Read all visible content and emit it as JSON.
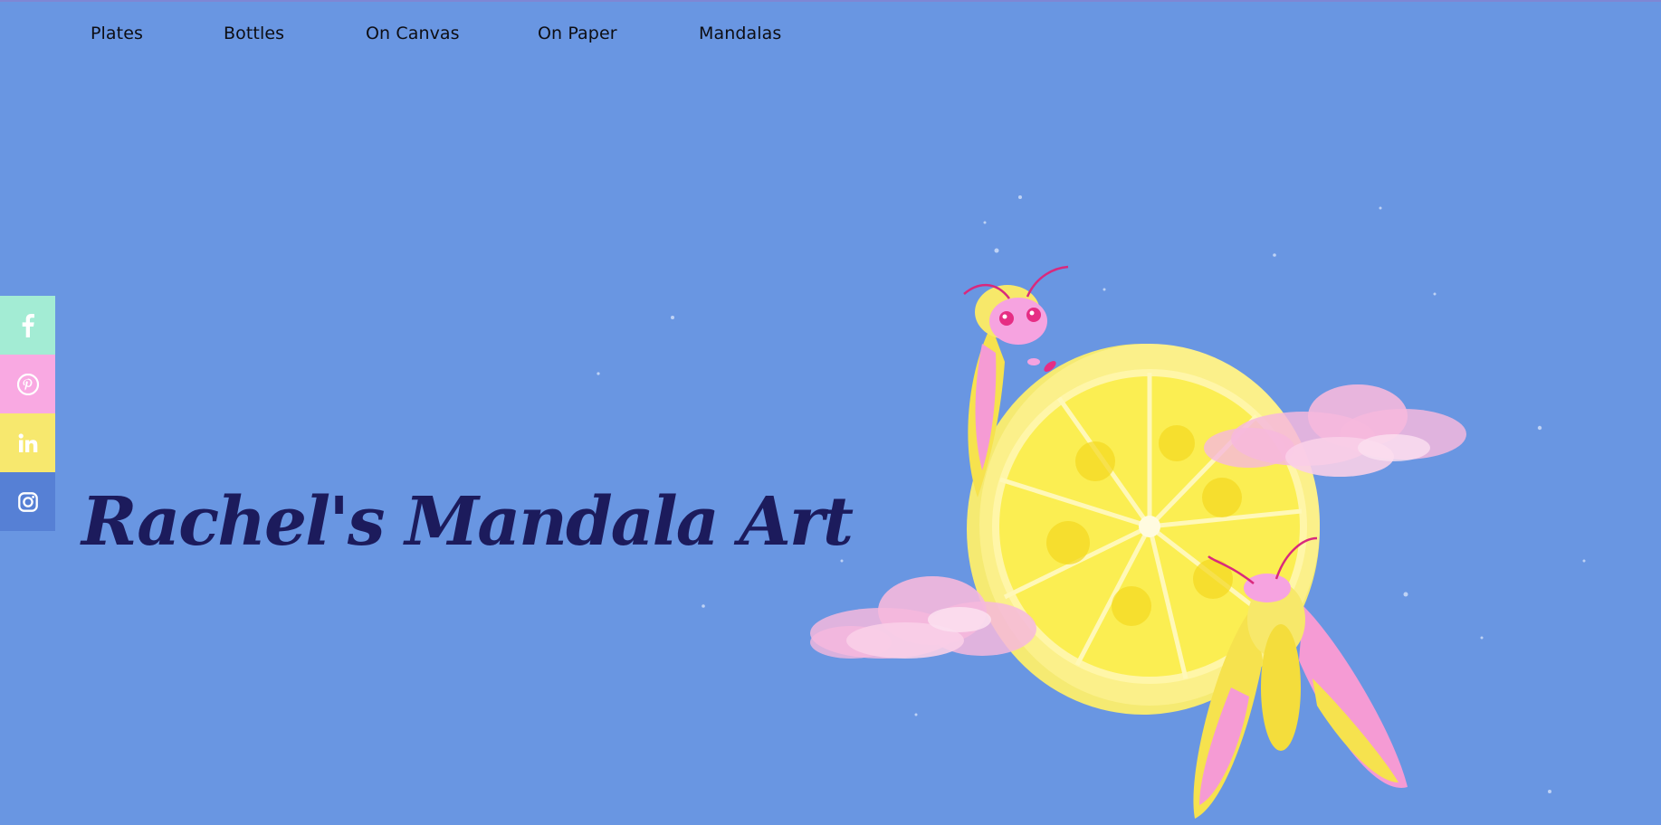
{
  "nav": {
    "items": [
      {
        "label": "Plates"
      },
      {
        "label": "Bottles"
      },
      {
        "label": "On Canvas"
      },
      {
        "label": "On Paper"
      },
      {
        "label": "Mandalas"
      }
    ]
  },
  "social": {
    "items": [
      {
        "icon": "facebook-icon",
        "color": "#a3ecd4"
      },
      {
        "icon": "pinterest-icon",
        "color": "#f9a9e2"
      },
      {
        "icon": "linkedin-icon",
        "color": "#f7e86e"
      },
      {
        "icon": "instagram-icon",
        "color": "#5680d5"
      }
    ]
  },
  "hero": {
    "title": "Rachel's Mandala Art"
  },
  "colors": {
    "background": "#6996e2",
    "title": "#1c1b5c",
    "lemon": "#f8e537",
    "cloud": "#f6b8dd",
    "moth_pink": "#f59bd4"
  }
}
